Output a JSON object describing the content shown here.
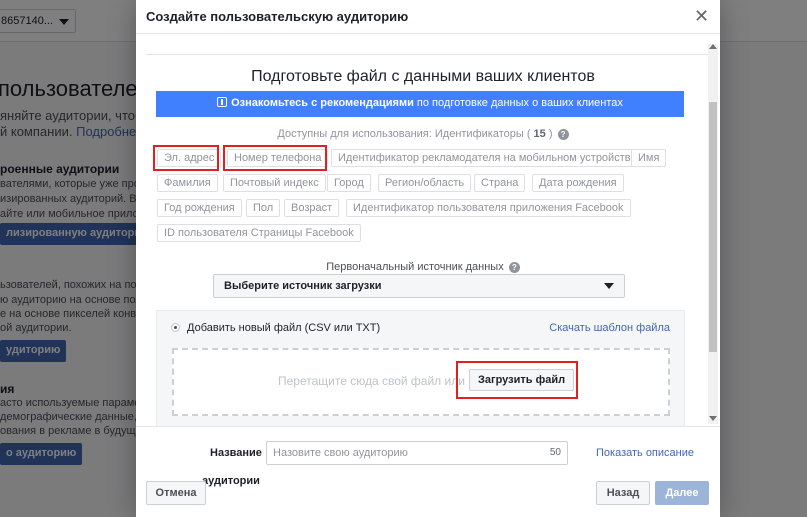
{
  "background": {
    "account_id": "8657140...",
    "heading": "пользователей, к",
    "intro_line1": "яняйте аудитории, чтобы",
    "intro_line2_text": "й компании.",
    "intro_link": "Подробнее",
    "saved_heading": "роенные аудитории",
    "saved_line1": "вателями, которые уже проя",
    "saved_line2": "изированных аудиторий. Вы м",
    "saved_line3": "айте или мобильное прилож",
    "saved_button": "лизированную аудиторию",
    "lookalike_line1": "ьзователей, похожих на пол",
    "lookalike_line2": "ю аудиторию на основе пол",
    "lookalike_line3": "е на основе пикселей конве",
    "lookalike_line4": "ой аудитории.",
    "lookalike_button": "удиторию",
    "saved2_heading": "ия",
    "saved2_line1": "асто используемые параметр",
    "saved2_line2": "демографические данные, и",
    "saved2_line3": "ования в рекламе в будуще",
    "saved2_button": "о аудиторию"
  },
  "modal": {
    "title": "Создайте пользовательскую аудиторию",
    "close_symbol": "✕",
    "section_title": "Подготовьте файл с данными ваших клиентов",
    "banner_bold": "Ознакомьтесь с рекомендациями",
    "banner_rest": " по подготовке данных о ваших клиентах",
    "available_prefix": "Доступны для использования: Идентификаторы ( ",
    "available_count": "15",
    "available_suffix": " )",
    "help_symbol": "?",
    "identifiers": [
      "Эл. адрес",
      "Номер телефона",
      "Идентификатор рекламодателя на мобильном устройстве",
      "Имя",
      "Фамилия",
      "Почтовый индекс",
      "Город",
      "Регион/область",
      "Страна",
      "Дата рождения",
      "Год рождения",
      "Пол",
      "Возраст",
      "Идентификатор пользователя приложения Facebook",
      "ID пользователя Страницы Facebook"
    ],
    "source_label": "Первоначальный источник данных",
    "source_select": "Выберите источник загрузки",
    "add_new_file": "Добавить новый файл (CSV или TXT)",
    "download_template": "Скачать шаблон файла",
    "drop_text": "Перетащите сюда свой файл или",
    "upload_button": "Загрузить файл",
    "name_label": "Название",
    "name_placeholder": "Назовите свою аудиторию",
    "name_char_count": "50",
    "show_description": "Показать описание",
    "peek_text": "аудитории",
    "cancel_button": "Отмена",
    "back_button": "Назад",
    "next_button": "Далее"
  },
  "colors": {
    "highlight_red": "#e0211d",
    "banner_blue": "#4080ff",
    "link_blue": "#4267b2",
    "disabled_next": "#9cb4d8"
  }
}
